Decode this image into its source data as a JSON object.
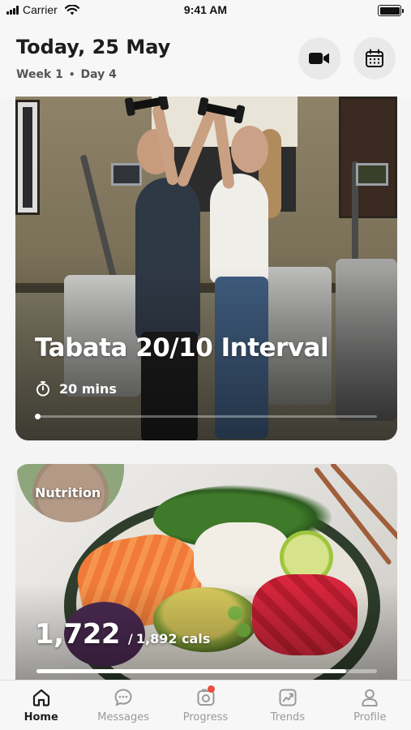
{
  "status_bar": {
    "carrier": "Carrier",
    "time": "9:41 AM"
  },
  "header": {
    "title": "Today, 25 May",
    "week": "Week 1",
    "separator": "•",
    "day": "Day 4",
    "video_button_icon": "video-camera-icon",
    "calendar_button_icon": "calendar-icon"
  },
  "workout_card": {
    "title": "Tabata 20/10 Interval",
    "duration": "20 mins",
    "duration_icon": "stopwatch-icon",
    "progress_fraction": 0.01
  },
  "nutrition_card": {
    "label": "Nutrition",
    "calories_consumed": "1,722",
    "separator": "/",
    "calories_goal": "1,892 cals",
    "calorie_fraction": 0.91
  },
  "tab_bar": {
    "items": [
      {
        "label": "Home",
        "icon": "home-icon",
        "active": true
      },
      {
        "label": "Messages",
        "icon": "chat-bubble-icon",
        "active": false
      },
      {
        "label": "Progress",
        "icon": "camera-icon",
        "active": false
      },
      {
        "label": "Trends",
        "icon": "trend-chart-icon",
        "active": false
      },
      {
        "label": "Profile",
        "icon": "person-icon",
        "active": false
      }
    ],
    "notification_color": "#ee4b3b"
  },
  "colors": {
    "background": "#f4f4f5",
    "text_dark": "#1d1d1f",
    "inactive_tab": "#9a9a9e",
    "button_bg": "#e9e9ea"
  }
}
